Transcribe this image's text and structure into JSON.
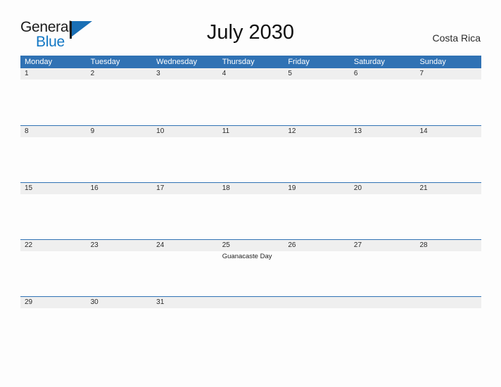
{
  "brand": {
    "name_part1": "General",
    "name_part2": "Blue",
    "flag_icon": "flag-icon",
    "accent_color": "#1277c4"
  },
  "header": {
    "title": "July 2030",
    "region": "Costa Rica"
  },
  "theme": {
    "header_blue": "#3072b4",
    "band_gray": "#efefef",
    "page_background": "#fdfdfd",
    "text_color": "#1a1a1a"
  },
  "calendar": {
    "weekdays": [
      "Monday",
      "Tuesday",
      "Wednesday",
      "Thursday",
      "Friday",
      "Saturday",
      "Sunday"
    ],
    "weeks": [
      {
        "days": [
          {
            "num": "1",
            "events": []
          },
          {
            "num": "2",
            "events": []
          },
          {
            "num": "3",
            "events": []
          },
          {
            "num": "4",
            "events": []
          },
          {
            "num": "5",
            "events": []
          },
          {
            "num": "6",
            "events": []
          },
          {
            "num": "7",
            "events": []
          }
        ]
      },
      {
        "days": [
          {
            "num": "8",
            "events": []
          },
          {
            "num": "9",
            "events": []
          },
          {
            "num": "10",
            "events": []
          },
          {
            "num": "11",
            "events": []
          },
          {
            "num": "12",
            "events": []
          },
          {
            "num": "13",
            "events": []
          },
          {
            "num": "14",
            "events": []
          }
        ]
      },
      {
        "days": [
          {
            "num": "15",
            "events": []
          },
          {
            "num": "16",
            "events": []
          },
          {
            "num": "17",
            "events": []
          },
          {
            "num": "18",
            "events": []
          },
          {
            "num": "19",
            "events": []
          },
          {
            "num": "20",
            "events": []
          },
          {
            "num": "21",
            "events": []
          }
        ]
      },
      {
        "days": [
          {
            "num": "22",
            "events": []
          },
          {
            "num": "23",
            "events": []
          },
          {
            "num": "24",
            "events": []
          },
          {
            "num": "25",
            "events": [
              "Guanacaste Day"
            ]
          },
          {
            "num": "26",
            "events": []
          },
          {
            "num": "27",
            "events": []
          },
          {
            "num": "28",
            "events": []
          }
        ]
      },
      {
        "days": [
          {
            "num": "29",
            "events": []
          },
          {
            "num": "30",
            "events": []
          },
          {
            "num": "31",
            "events": []
          },
          {
            "num": "",
            "events": []
          },
          {
            "num": "",
            "events": []
          },
          {
            "num": "",
            "events": []
          },
          {
            "num": "",
            "events": []
          }
        ]
      }
    ]
  }
}
